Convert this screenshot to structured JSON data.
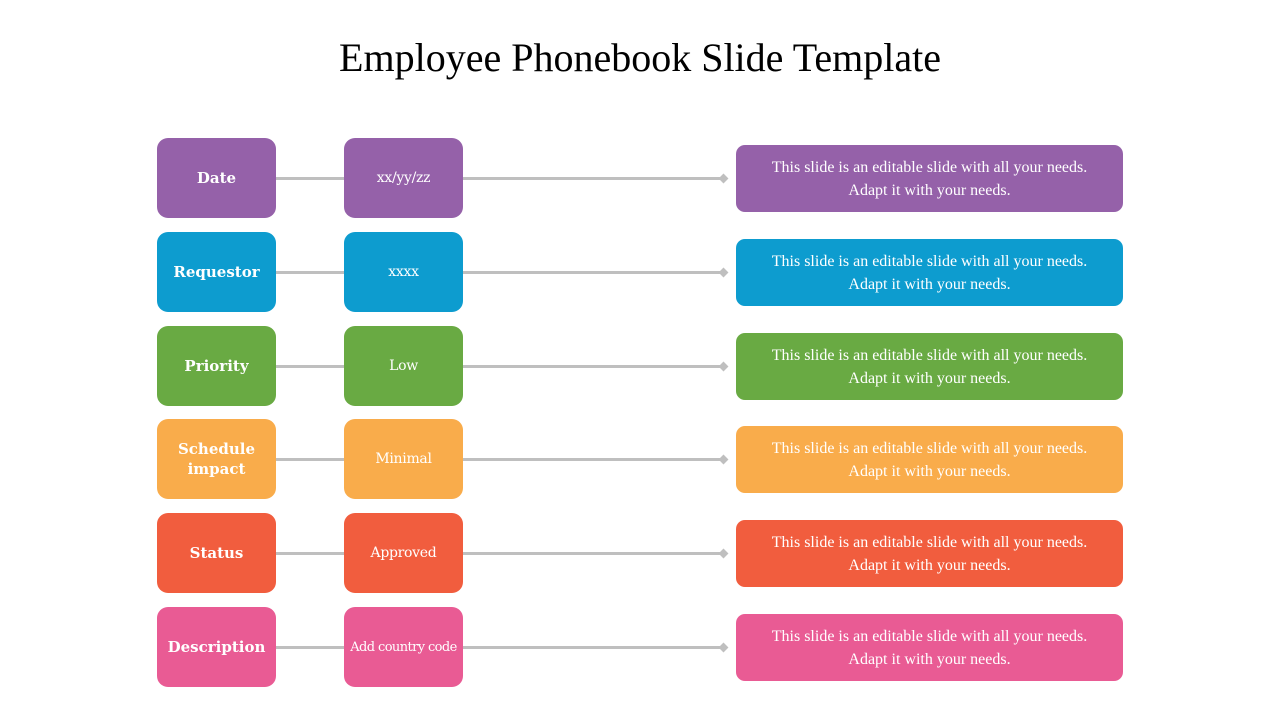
{
  "title": "Employee Phonebook Slide Template",
  "rows": [
    {
      "label": "Date",
      "value": "xx/yy/zz",
      "desc_line1": "This slide is an editable slide with all your needs.",
      "desc_line2": "Adapt it with your needs.",
      "color": "#9561a9"
    },
    {
      "label": "Requestor",
      "value": "xxxx",
      "desc_line1": "This slide is an editable slide with all your needs.",
      "desc_line2": "Adapt it with your needs.",
      "color": "#0d9ccf"
    },
    {
      "label": "Priority",
      "value": "Low",
      "desc_line1": "This slide is an editable slide with all your needs.",
      "desc_line2": "Adapt it with your needs.",
      "color": "#69aa43"
    },
    {
      "label": "Schedule impact",
      "value": "Minimal",
      "desc_line1": "This slide is an editable slide with all your needs.",
      "desc_line2": "Adapt it with your needs.",
      "color": "#f9ac4b"
    },
    {
      "label": "Status",
      "value": "Approved",
      "desc_line1": "This slide is an editable slide with all your needs.",
      "desc_line2": "Adapt it with your needs.",
      "color": "#f15d3e"
    },
    {
      "label": "Description",
      "value": "Add country code",
      "desc_line1": "This slide is an editable slide with all your needs.",
      "desc_line2": "Adapt it with your needs.",
      "color": "#e95b94"
    }
  ],
  "connector_color": "#bfbfbf"
}
